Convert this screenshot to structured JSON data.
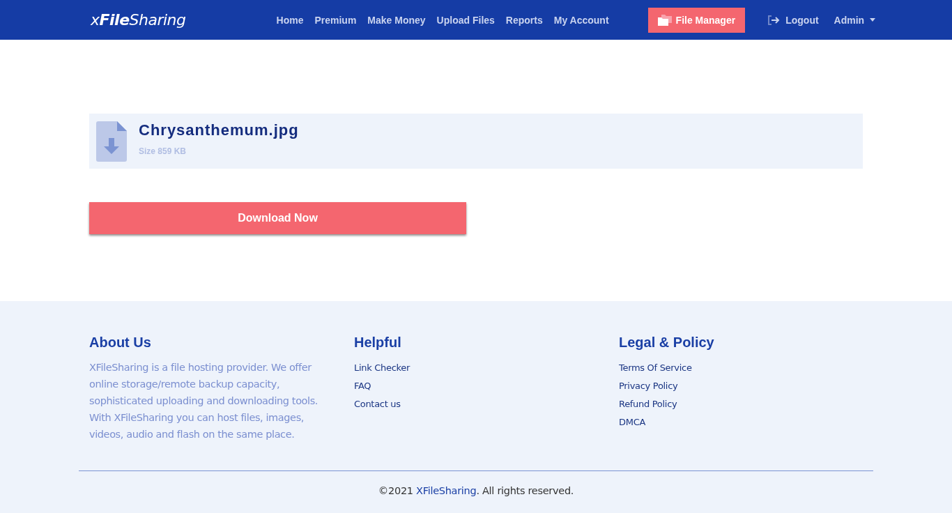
{
  "navbar": {
    "logo": "x**File**Sharing",
    "links": [
      "Home",
      "Premium",
      "Make Money",
      "Upload Files",
      "Reports",
      "My Account"
    ],
    "file_manager_button": "File Manager",
    "logout": "Logout",
    "user_menu": "Admin"
  },
  "file": {
    "name": "Chrysanthemum.jpg",
    "size": "Size 859 KB"
  },
  "download_button": "Download Now",
  "footer": {
    "columns": [
      {
        "heading": "About Us",
        "kind": "text",
        "text": "XFileSharing is a file hosting provider. We offer online storage/remote backup capacity, sophisticated uploading and downloading tools. With XFileSharing you can host files, images, videos, audio and flash on the same place."
      },
      {
        "heading": "Helpful",
        "kind": "links",
        "links": [
          "Link Checker",
          "FAQ",
          "Contact us"
        ]
      },
      {
        "heading": "Legal & Policy",
        "kind": "links",
        "links": [
          "Terms Of Service",
          "Privacy Policy",
          "Refund Policy",
          "DMCA"
        ]
      }
    ],
    "copyright": {
      "prefix": "©2021",
      "link": "XFileSharing",
      "suffix": ". All rights reserved."
    }
  }
}
